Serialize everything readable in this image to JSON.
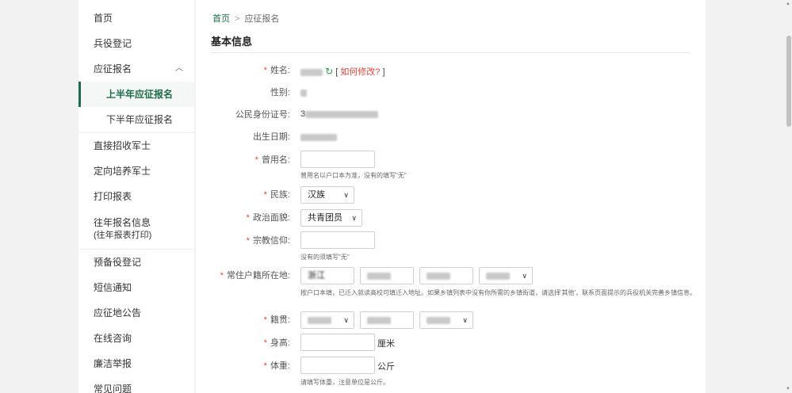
{
  "sidebar": {
    "items": [
      {
        "label": "首页"
      },
      {
        "label": "兵役登记"
      },
      {
        "label": "应征报名"
      },
      {
        "label": "上半年应征报名"
      },
      {
        "label": "下半年应征报名"
      },
      {
        "label": "直接招收军士"
      },
      {
        "label": "定向培养军士"
      },
      {
        "label": "打印报表"
      },
      {
        "label": "往年报名信息",
        "label2": "(往年报表打印)"
      },
      {
        "label": "预备役登记"
      },
      {
        "label": "短信通知"
      },
      {
        "label": "应征地公告"
      },
      {
        "label": "在线咨询"
      },
      {
        "label": "廉洁举报"
      },
      {
        "label": "常见问题"
      }
    ]
  },
  "breadcrumb": {
    "home": "首页",
    "sep": ">",
    "current": "应征报名"
  },
  "section": {
    "title": "基本信息"
  },
  "form": {
    "name": {
      "label": "姓名:",
      "bracket_open": "[",
      "link": "如何修改?",
      "bracket_close": "]"
    },
    "gender": {
      "label": "性别:"
    },
    "id_number": {
      "label": "公民身份证号:",
      "prefix": "3"
    },
    "birth": {
      "label": "出生日期:"
    },
    "former_name": {
      "label": "曾用名:",
      "hint": "曾用名以户口本为准，没有的填写\"无\""
    },
    "ethnicity": {
      "label": "民族:",
      "value": "汉族"
    },
    "political": {
      "label": "政治面貌:",
      "value": "共青团员"
    },
    "religion": {
      "label": "宗教信仰:",
      "hint": "没有的须填写\"无\""
    },
    "residence": {
      "label": "常住户籍所在地:",
      "first": "浙江",
      "hint": "按户口本填，已迁入就读高校可填迁入地址。如果乡镇列表中没有你所需的乡镇街道，请选择'其他'，联系页面提示的兵役机关完善乡镇信息。"
    },
    "native": {
      "label": "籍贯:"
    },
    "height": {
      "label": "身高:",
      "unit": "厘米"
    },
    "weight": {
      "label": "体重:",
      "unit": "公斤",
      "hint": "请填写体重，注意单位是公斤。"
    }
  },
  "colors": {
    "accent": "#1d6b4a",
    "required": "#e0473c",
    "refresh": "#2f9a4a"
  }
}
